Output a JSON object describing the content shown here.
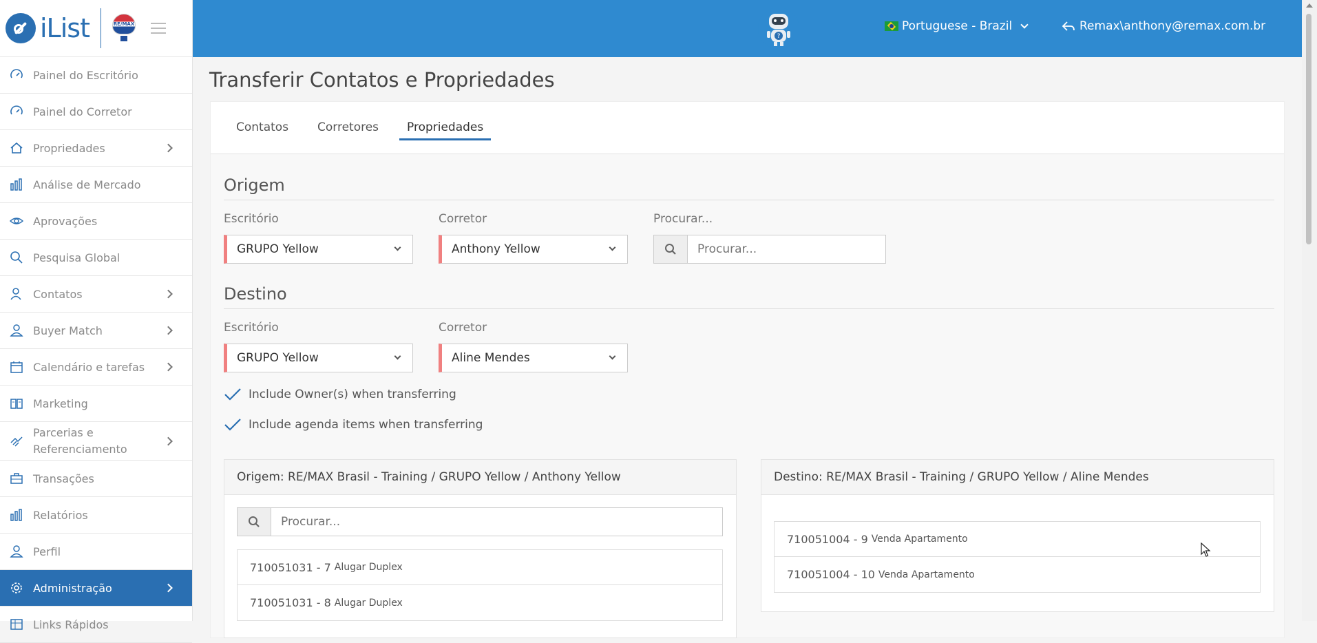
{
  "brand": {
    "logo_text": "iList",
    "partner_logo_text": "RE/MAX"
  },
  "sidebar": {
    "items": [
      {
        "label": "Painel do Escritório",
        "icon": "dashboard-icon",
        "has_arrow": false
      },
      {
        "label": "Painel do Corretor",
        "icon": "dashboard-icon",
        "has_arrow": false
      },
      {
        "label": "Propriedades",
        "icon": "home-icon",
        "has_arrow": true
      },
      {
        "label": "Análise de Mercado",
        "icon": "bar-chart-icon",
        "has_arrow": false
      },
      {
        "label": "Aprovações",
        "icon": "eye-icon",
        "has_arrow": false
      },
      {
        "label": "Pesquisa Global",
        "icon": "search-icon",
        "has_arrow": false
      },
      {
        "label": "Contatos",
        "icon": "users-icon",
        "has_arrow": true
      },
      {
        "label": "Buyer Match",
        "icon": "user-icon",
        "has_arrow": true
      },
      {
        "label": "Calendário e tarefas",
        "icon": "calendar-icon",
        "has_arrow": true
      },
      {
        "label": "Marketing",
        "icon": "book-icon",
        "has_arrow": false
      },
      {
        "label": "Parcerias e Referenciamento",
        "icon": "handshake-icon",
        "has_arrow": true
      },
      {
        "label": "Transações",
        "icon": "briefcase-icon",
        "has_arrow": false
      },
      {
        "label": "Relatórios",
        "icon": "bar-chart-icon",
        "has_arrow": false
      },
      {
        "label": "Perfil",
        "icon": "user-icon",
        "has_arrow": false
      },
      {
        "label": "Administração",
        "icon": "gear-icon",
        "has_arrow": true,
        "active": true
      },
      {
        "label": "Links Rápidos",
        "icon": "grid-icon",
        "has_arrow": false
      }
    ]
  },
  "topbar": {
    "language": "Portuguese - Brazil",
    "user": "Remax\\anthony@remax.com.br"
  },
  "page": {
    "title": "Transferir Contatos e Propriedades",
    "tabs": [
      "Contatos",
      "Corretores",
      "Propriedades"
    ],
    "active_tab": "Propriedades"
  },
  "origem": {
    "title": "Origem",
    "office_label": "Escritório",
    "office_value": "GRUPO Yellow",
    "agent_label": "Corretor",
    "agent_value": "Anthony Yellow",
    "search_label": "Procurar...",
    "search_placeholder": "Procurar..."
  },
  "destino": {
    "title": "Destino",
    "office_label": "Escritório",
    "office_value": "GRUPO Yellow",
    "agent_label": "Corretor",
    "agent_value": "Aline Mendes"
  },
  "options": {
    "include_owners": "Include Owner(s) when transferring",
    "include_agenda": "Include agenda items when transferring"
  },
  "origem_panel": {
    "header": "Origem: RE/MAX Brasil - Training / GRUPO Yellow / Anthony Yellow",
    "search_placeholder": "Procurar...",
    "items": [
      {
        "code": "710051031 - 7",
        "desc": "Alugar Duplex"
      },
      {
        "code": "710051031 - 8",
        "desc": "Alugar Duplex"
      }
    ]
  },
  "destino_panel": {
    "header": "Destino: RE/MAX Brasil - Training / GRUPO Yellow / Aline Mendes",
    "items": [
      {
        "code": "710051004 - 9",
        "desc": "Venda Apartamento"
      },
      {
        "code": "710051004 - 10",
        "desc": "Venda Apartamento"
      }
    ]
  },
  "colors": {
    "primary": "#2a6fb2",
    "topbar": "#2f8ad0",
    "required_marker": "#f08080"
  }
}
